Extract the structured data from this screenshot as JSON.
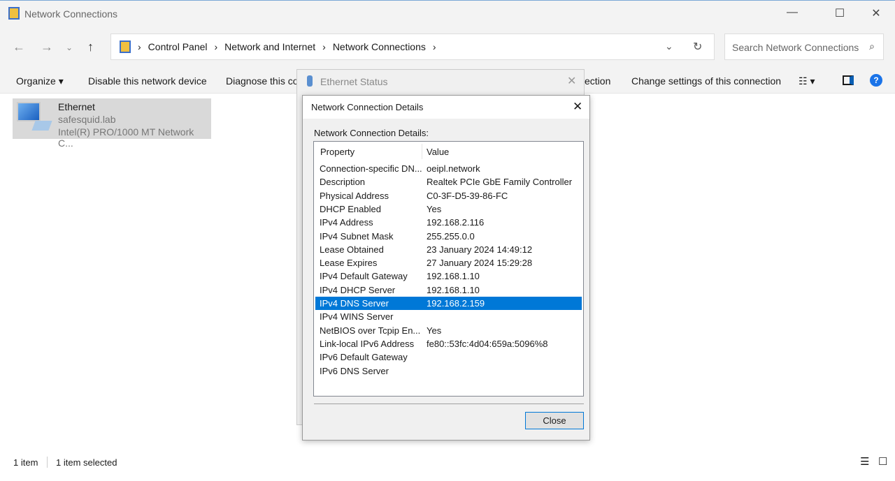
{
  "window": {
    "title": "Network Connections"
  },
  "address": {
    "crumbs": [
      "Control Panel",
      "Network and Internet",
      "Network Connections"
    ],
    "search_placeholder": "Search Network Connections"
  },
  "toolbar": {
    "organize": "Organize",
    "disable": "Disable this network device",
    "diagnose": "Diagnose this co",
    "rename_tail": "ection",
    "change": "Change settings of this connection"
  },
  "item": {
    "name": "Ethernet",
    "domain": "safesquid.lab",
    "adapter": "Intel(R) PRO/1000 MT Network C..."
  },
  "statusbar": {
    "count": "1 item",
    "selected": "1 item selected"
  },
  "ethernet_status": {
    "title": "Ethernet Status"
  },
  "details": {
    "title": "Network Connection Details",
    "label": "Network Connection Details:",
    "col_property": "Property",
    "col_value": "Value",
    "close": "Close",
    "selected_index": 10,
    "rows": [
      {
        "p": "Connection-specific DN...",
        "v": "oeipl.network"
      },
      {
        "p": "Description",
        "v": "Realtek PCIe GbE Family Controller"
      },
      {
        "p": "Physical Address",
        "v": "C0-3F-D5-39-86-FC"
      },
      {
        "p": "DHCP Enabled",
        "v": "Yes"
      },
      {
        "p": "IPv4 Address",
        "v": "192.168.2.116"
      },
      {
        "p": "IPv4 Subnet Mask",
        "v": "255.255.0.0"
      },
      {
        "p": "Lease Obtained",
        "v": "23 January 2024 14:49:12"
      },
      {
        "p": "Lease Expires",
        "v": "27 January 2024 15:29:28"
      },
      {
        "p": "IPv4 Default Gateway",
        "v": "192.168.1.10"
      },
      {
        "p": "IPv4 DHCP Server",
        "v": "192.168.1.10"
      },
      {
        "p": "IPv4 DNS Server",
        "v": "192.168.2.159"
      },
      {
        "p": "IPv4 WINS Server",
        "v": ""
      },
      {
        "p": "NetBIOS over Tcpip En...",
        "v": "Yes"
      },
      {
        "p": "Link-local IPv6 Address",
        "v": "fe80::53fc:4d04:659a:5096%8"
      },
      {
        "p": "IPv6 Default Gateway",
        "v": ""
      },
      {
        "p": "IPv6 DNS Server",
        "v": ""
      }
    ]
  }
}
